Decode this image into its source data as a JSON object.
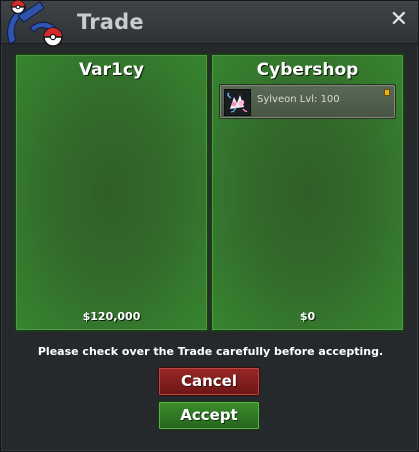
{
  "window": {
    "title": "Trade",
    "close_icon": "close-icon",
    "logo_icon": "pokeball-logo-icon"
  },
  "left_panel": {
    "name": "Var1cy",
    "money": "$120,000",
    "items": []
  },
  "right_panel": {
    "name": "Cybershop",
    "money": "$0",
    "items": [
      {
        "icon": "sylveon-sprite-icon",
        "label": "Sylveon  Lvl: 100",
        "badge": "item-flag-icon"
      }
    ]
  },
  "message": "Please check over the Trade carefully before accepting.",
  "buttons": {
    "cancel_label": "Cancel",
    "accept_label": "Accept"
  },
  "colors": {
    "panel_green": "#326b2a",
    "cancel_red": "#8a2020",
    "accept_green": "#2f7a24",
    "badge_gold": "#e8b21a"
  }
}
